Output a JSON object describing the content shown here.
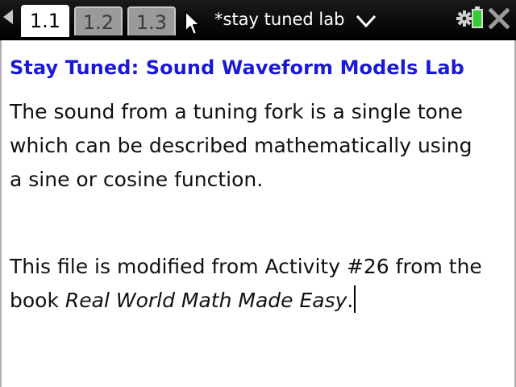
{
  "toolbar": {
    "tabs": [
      {
        "label": "1.1",
        "active": true
      },
      {
        "label": "1.2",
        "active": false
      },
      {
        "label": "1.3",
        "active": false
      }
    ],
    "document_title": "*stay tuned lab",
    "icons": [
      "nav-left-arrow-icon",
      "mouse-pointer-icon",
      "chevron-down-icon",
      "gear-icon",
      "battery-icon",
      "close-icon"
    ],
    "colors": {
      "bar": "#000000",
      "active_tab": "#ffffff",
      "inactive_tab": "#9a9a9a",
      "battery": "#33cc33",
      "close": "#888888"
    }
  },
  "page": {
    "heading": "Stay Tuned: Sound Waveform Models Lab",
    "heading_color": "#1a1ad6",
    "paragraph1": {
      "lines": [
        "The sound from a tuning fork is a single tone",
        "which can be described mathematically using",
        "a sine or cosine function."
      ]
    },
    "paragraph2": {
      "line1": "This file is modified from Activity #26 from the",
      "line2_prefix": "book ",
      "book_title": "Real World Math Made Easy",
      "line2_suffix": "."
    }
  }
}
